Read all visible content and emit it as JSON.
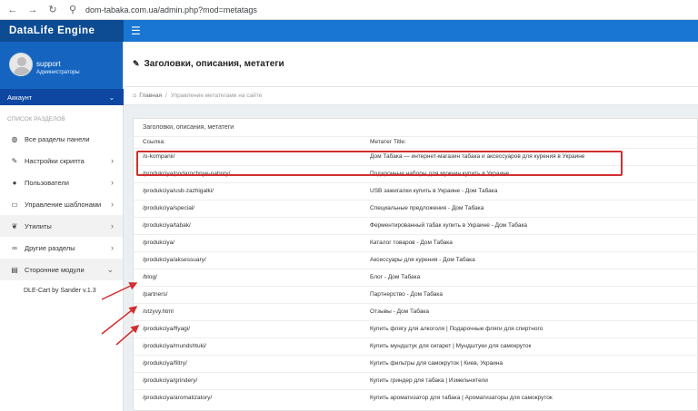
{
  "browser": {
    "url": "dom-tabaka.com.ua/admin.php?mod=metatags"
  },
  "app": {
    "brand": "DataLife Engine"
  },
  "profile": {
    "name": "support",
    "role": "Администраторы",
    "account_label": "Аккаунт"
  },
  "sidebar": {
    "section_title": "СПИСОК РАЗДЕЛОВ",
    "items": [
      {
        "label": "Все разделы панели",
        "icon": "globe-icon",
        "chevron": ""
      },
      {
        "label": "Настройки скрипта",
        "icon": "wrench-icon",
        "chevron": "›"
      },
      {
        "label": "Пользователи",
        "icon": "user-icon",
        "chevron": "›"
      },
      {
        "label": "Управление шаблонами",
        "icon": "monitor-icon",
        "chevron": "›"
      },
      {
        "label": "Утилиты",
        "icon": "leaf-icon",
        "chevron": "›"
      },
      {
        "label": "Другие разделы",
        "icon": "link-icon",
        "chevron": "›"
      },
      {
        "label": "Сторонние модули",
        "icon": "grid-icon",
        "chevron": "⌄"
      }
    ],
    "sub_item": "DLE-Cart by Sander v.1.3"
  },
  "page": {
    "title": "Заголовки, описания, метатеги",
    "breadcrumb_home": "Главная",
    "breadcrumb_current": "Управление метатегами на сайте",
    "panel_title": "Заголовки, описания, метатеги"
  },
  "table": {
    "headers": [
      "Ссылка:",
      "Метатег Title:"
    ],
    "rows": [
      [
        "/o-kompanii/",
        "Дом Табака — интернет-магазин табака и аксессуаров для курения в Украине"
      ],
      [
        "/produkciya/podarochnye-nabory/",
        "Подарочные наборы для мужчин купить в Украине"
      ],
      [
        "/produkciya/usb-zazhigalki/",
        "USB зажигалки купить в Украине - Дом Табака"
      ],
      [
        "/produkciya/special/",
        "Специальные предложения - Дом Табака"
      ],
      [
        "/produkciya/tabak/",
        "Ферментированный табак купить в Украине - Дом Табака"
      ],
      [
        "/produkciya/",
        "Каталог товаров - Дом Табака"
      ],
      [
        "/produkciya/aksessuary/",
        "Аксессуары для курения - Дом Табака"
      ],
      [
        "/blog/",
        "Блог - Дом Табака"
      ],
      [
        "/partners/",
        "Партнерство - Дом Табака"
      ],
      [
        "/otzyvy.html",
        "Отзывы - Дом Табака"
      ],
      [
        "/produkciya/flyagi/",
        "Купить флягу для алкоголя | Подарочные фляги для спиртного"
      ],
      [
        "/produkciya/mundshtuki/",
        "Купить мундштук для сигарет | Мундштуки для самокруток"
      ],
      [
        "/produkciya/filtry/",
        "Купить фильтры для самокруток | Киев, Украина"
      ],
      [
        "/produkciya/grindery/",
        "Купить гриндер для табака | Измельчители"
      ],
      [
        "/produkciya/aromatizatory/",
        "Купить ароматизатор для табака | Ароматизаторы для самокруток"
      ]
    ]
  },
  "colors": {
    "brand_dark": "#0d4c93",
    "brand": "#1976d2",
    "highlight": "#d32f2f"
  }
}
